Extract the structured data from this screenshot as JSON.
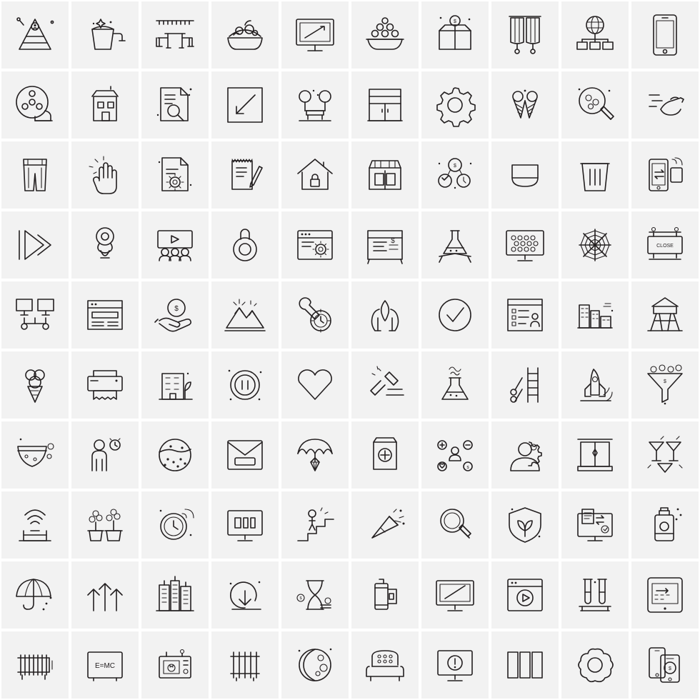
{
  "sheet": {
    "title": "Line Icon Set",
    "columns": 10,
    "rows": 10,
    "cell_background": "#f2f2f2",
    "page_background": "#ffffff",
    "stroke_color": "#231f20",
    "icons": [
      {
        "row": 1,
        "col": 1,
        "name": "hierarchy-pyramid-icon",
        "label": ""
      },
      {
        "row": 1,
        "col": 2,
        "name": "cleaning-bucket-icon",
        "label": ""
      },
      {
        "row": 1,
        "col": 3,
        "name": "cafe-table-umbrella-icon",
        "label": ""
      },
      {
        "row": 1,
        "col": 4,
        "name": "salad-bowl-icon",
        "label": ""
      },
      {
        "row": 1,
        "col": 5,
        "name": "desktop-monitor-icon",
        "label": ""
      },
      {
        "row": 1,
        "col": 6,
        "name": "fruit-bowl-stack-icon",
        "label": ""
      },
      {
        "row": 1,
        "col": 7,
        "name": "donation-money-box-icon",
        "label": ""
      },
      {
        "row": 1,
        "col": 8,
        "name": "double-curtain-icon",
        "label": ""
      },
      {
        "row": 1,
        "col": 9,
        "name": "global-network-icon",
        "label": ""
      },
      {
        "row": 1,
        "col": 10,
        "name": "smartphone-icon",
        "label": ""
      },
      {
        "row": 2,
        "col": 1,
        "name": "film-reel-icon",
        "label": ""
      },
      {
        "row": 2,
        "col": 2,
        "name": "building-house-icon",
        "label": ""
      },
      {
        "row": 2,
        "col": 3,
        "name": "document-search-icon",
        "label": ""
      },
      {
        "row": 2,
        "col": 4,
        "name": "resize-box-arrow-icon",
        "label": ""
      },
      {
        "row": 2,
        "col": 5,
        "name": "park-bench-trees-icon",
        "label": ""
      },
      {
        "row": 2,
        "col": 6,
        "name": "cabinet-cupboard-icon",
        "label": ""
      },
      {
        "row": 2,
        "col": 7,
        "name": "settings-gear-icon",
        "label": ""
      },
      {
        "row": 2,
        "col": 8,
        "name": "two-ice-cream-cones-icon",
        "label": ""
      },
      {
        "row": 2,
        "col": 9,
        "name": "magnifier-coins-icon",
        "label": ""
      },
      {
        "row": 2,
        "col": 10,
        "name": "hand-speed-lines-icon",
        "label": ""
      },
      {
        "row": 3,
        "col": 1,
        "name": "jeans-trousers-icon",
        "label": ""
      },
      {
        "row": 3,
        "col": 2,
        "name": "hand-move-gesture-icon",
        "label": ""
      },
      {
        "row": 3,
        "col": 3,
        "name": "document-settings-icon",
        "label": ""
      },
      {
        "row": 3,
        "col": 4,
        "name": "notebook-pen-icon",
        "label": ""
      },
      {
        "row": 3,
        "col": 5,
        "name": "secure-home-icon",
        "label": ""
      },
      {
        "row": 3,
        "col": 6,
        "name": "market-shop-icon",
        "label": ""
      },
      {
        "row": 3,
        "col": 7,
        "name": "money-time-management-icon",
        "label": ""
      },
      {
        "row": 3,
        "col": 8,
        "name": "eraser-icon",
        "label": ""
      },
      {
        "row": 3,
        "col": 9,
        "name": "trash-bin-icon",
        "label": ""
      },
      {
        "row": 3,
        "col": 10,
        "name": "mobile-data-transfer-icon",
        "label": ""
      },
      {
        "row": 4,
        "col": 1,
        "name": "play-forward-icon",
        "label": ""
      },
      {
        "row": 4,
        "col": 2,
        "name": "baby-pacifier-icon",
        "label": ""
      },
      {
        "row": 4,
        "col": 3,
        "name": "video-webinar-icon",
        "label": ""
      },
      {
        "row": 4,
        "col": 4,
        "name": "padlock-round-icon",
        "label": ""
      },
      {
        "row": 4,
        "col": 5,
        "name": "browser-settings-icon",
        "label": ""
      },
      {
        "row": 4,
        "col": 6,
        "name": "price-board-dollar-icon",
        "label": ""
      },
      {
        "row": 4,
        "col": 7,
        "name": "lab-flask-stand-icon",
        "label": ""
      },
      {
        "row": 4,
        "col": 8,
        "name": "monitor-grid-dots-icon",
        "label": ""
      },
      {
        "row": 4,
        "col": 9,
        "name": "spider-web-icon",
        "label": ""
      },
      {
        "row": 4,
        "col": 10,
        "name": "close-sign-board-icon",
        "label": "CLOSE"
      },
      {
        "row": 5,
        "col": 1,
        "name": "network-computers-icon",
        "label": ""
      },
      {
        "row": 5,
        "col": 2,
        "name": "browser-window-icon",
        "label": ""
      },
      {
        "row": 5,
        "col": 3,
        "name": "hand-dollar-coin-icon",
        "label": ""
      },
      {
        "row": 5,
        "col": 4,
        "name": "mountain-peak-icon",
        "label": ""
      },
      {
        "row": 5,
        "col": 5,
        "name": "wrench-gear-clock-icon",
        "label": ""
      },
      {
        "row": 5,
        "col": 6,
        "name": "caring-hands-ribbon-icon",
        "label": ""
      },
      {
        "row": 5,
        "col": 7,
        "name": "check-circle-icon",
        "label": ""
      },
      {
        "row": 5,
        "col": 8,
        "name": "user-profile-list-icon",
        "label": ""
      },
      {
        "row": 5,
        "col": 9,
        "name": "city-buildings-icon",
        "label": ""
      },
      {
        "row": 5,
        "col": 10,
        "name": "watchtower-icon",
        "label": ""
      },
      {
        "row": 6,
        "col": 1,
        "name": "ice-cream-cone-icon",
        "label": ""
      },
      {
        "row": 6,
        "col": 2,
        "name": "printer-receipt-icon",
        "label": ""
      },
      {
        "row": 6,
        "col": 3,
        "name": "office-building-plant-icon",
        "label": ""
      },
      {
        "row": 6,
        "col": 4,
        "name": "pause-button-circle-icon",
        "label": ""
      },
      {
        "row": 6,
        "col": 5,
        "name": "heart-outline-icon",
        "label": ""
      },
      {
        "row": 6,
        "col": 6,
        "name": "auction-gavel-icon",
        "label": ""
      },
      {
        "row": 6,
        "col": 7,
        "name": "chemical-reaction-flask-icon",
        "label": ""
      },
      {
        "row": 6,
        "col": 8,
        "name": "ladder-scissors-icon",
        "label": ""
      },
      {
        "row": 6,
        "col": 9,
        "name": "rocket-launch-icon",
        "label": ""
      },
      {
        "row": 6,
        "col": 10,
        "name": "money-funnel-icon",
        "label": ""
      },
      {
        "row": 7,
        "col": 1,
        "name": "baby-diaper-icon",
        "label": ""
      },
      {
        "row": 7,
        "col": 2,
        "name": "person-alarm-icon",
        "label": ""
      },
      {
        "row": 7,
        "col": 3,
        "name": "cookie-icon",
        "label": ""
      },
      {
        "row": 7,
        "col": 4,
        "name": "open-envelope-icon",
        "label": ""
      },
      {
        "row": 7,
        "col": 5,
        "name": "umbrella-diamond-icon",
        "label": ""
      },
      {
        "row": 7,
        "col": 6,
        "name": "medical-supply-bag-icon",
        "label": ""
      },
      {
        "row": 7,
        "col": 7,
        "name": "social-media-user-icon",
        "label": ""
      },
      {
        "row": 7,
        "col": 8,
        "name": "user-settings-gear-icon",
        "label": ""
      },
      {
        "row": 7,
        "col": 9,
        "name": "window-frame-icon",
        "label": ""
      },
      {
        "row": 7,
        "col": 10,
        "name": "cocktail-glasses-icon",
        "label": ""
      },
      {
        "row": 8,
        "col": 1,
        "name": "wifi-signal-device-icon",
        "label": ""
      },
      {
        "row": 8,
        "col": 2,
        "name": "potted-plants-icon",
        "label": ""
      },
      {
        "row": 8,
        "col": 3,
        "name": "smart-clock-icon",
        "label": ""
      },
      {
        "row": 8,
        "col": 4,
        "name": "monitor-blocks-icon",
        "label": ""
      },
      {
        "row": 8,
        "col": 5,
        "name": "person-stairs-success-icon",
        "label": ""
      },
      {
        "row": 8,
        "col": 6,
        "name": "party-popper-icon",
        "label": ""
      },
      {
        "row": 8,
        "col": 7,
        "name": "magnifying-glass-icon",
        "label": ""
      },
      {
        "row": 8,
        "col": 8,
        "name": "eco-shield-leaf-icon",
        "label": ""
      },
      {
        "row": 8,
        "col": 9,
        "name": "monitor-document-transfer-icon",
        "label": ""
      },
      {
        "row": 8,
        "col": 10,
        "name": "spray-paint-can-icon",
        "label": ""
      },
      {
        "row": 9,
        "col": 1,
        "name": "open-umbrella-icon",
        "label": ""
      },
      {
        "row": 9,
        "col": 2,
        "name": "growth-arrows-up-icon",
        "label": ""
      },
      {
        "row": 9,
        "col": 3,
        "name": "skyscrapers-icon",
        "label": ""
      },
      {
        "row": 9,
        "col": 4,
        "name": "download-arrow-circle-icon",
        "label": ""
      },
      {
        "row": 9,
        "col": 5,
        "name": "hourglass-money-icon",
        "label": ""
      },
      {
        "row": 9,
        "col": 6,
        "name": "camera-film-roll-icon",
        "label": ""
      },
      {
        "row": 9,
        "col": 7,
        "name": "computer-screen-icon",
        "label": ""
      },
      {
        "row": 9,
        "col": 8,
        "name": "video-player-browser-icon",
        "label": ""
      },
      {
        "row": 9,
        "col": 9,
        "name": "test-tubes-rack-icon",
        "label": ""
      },
      {
        "row": 9,
        "col": 10,
        "name": "tablet-dotted-path-icon",
        "label": ""
      },
      {
        "row": 10,
        "col": 1,
        "name": "radiator-heater-icon",
        "label": ""
      },
      {
        "row": 10,
        "col": 2,
        "name": "physics-formula-board-icon",
        "label": "E=MC"
      },
      {
        "row": 10,
        "col": 3,
        "name": "microwave-oven-icon",
        "label": ""
      },
      {
        "row": 10,
        "col": 4,
        "name": "heating-radiator-icon",
        "label": ""
      },
      {
        "row": 10,
        "col": 5,
        "name": "moon-crater-icon",
        "label": ""
      },
      {
        "row": 10,
        "col": 6,
        "name": "armchair-sofa-icon",
        "label": ""
      },
      {
        "row": 10,
        "col": 7,
        "name": "monitor-alert-icon",
        "label": ""
      },
      {
        "row": 10,
        "col": 8,
        "name": "layout-columns-icon",
        "label": ""
      },
      {
        "row": 10,
        "col": 9,
        "name": "flower-gear-icon",
        "label": ""
      },
      {
        "row": 10,
        "col": 10,
        "name": "mobile-payment-icon",
        "label": ""
      }
    ]
  }
}
